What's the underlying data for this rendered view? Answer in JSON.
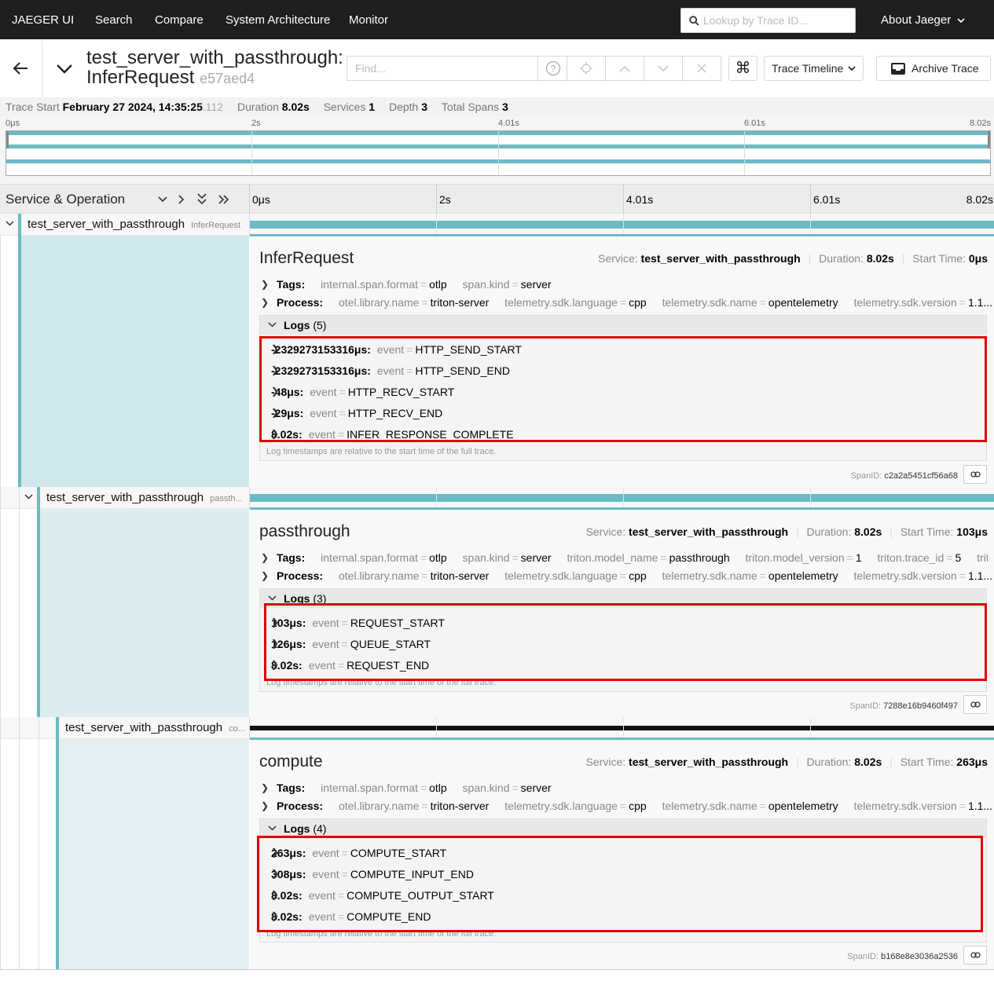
{
  "nav": {
    "brand": "JAEGER UI",
    "links": [
      "Search",
      "Compare",
      "System Architecture",
      "Monitor"
    ],
    "lookup_placeholder": "Lookup by Trace ID...",
    "about": "About Jaeger"
  },
  "trace": {
    "title_line1": "test_server_with_passthrough:",
    "title_line2": "InferRequest",
    "trace_id": "e57aed4",
    "find_placeholder": "Find...",
    "view_mode": "Trace Timeline",
    "archive_label": "Archive Trace"
  },
  "summary": {
    "start_label": "Trace Start",
    "start_value": "February 27 2024, 14:35:25",
    "start_ms": ".112",
    "duration_label": "Duration",
    "duration_value": "8.02s",
    "services_label": "Services",
    "services_value": "1",
    "depth_label": "Depth",
    "depth_value": "3",
    "spans_label": "Total Spans",
    "spans_value": "3"
  },
  "minimap_ticks": [
    "0μs",
    "2s",
    "4.01s",
    "6.01s",
    "8.02s"
  ],
  "timeline": {
    "column_title": "Service & Operation",
    "ticks": [
      "0μs",
      "2s",
      "4.01s",
      "6.01s",
      "8.02s"
    ]
  },
  "spans": [
    {
      "service": "test_server_with_passthrough",
      "operation": "InferRequest",
      "title": "InferRequest",
      "meta_service": "test_server_with_passthrough",
      "meta_duration": "8.02s",
      "meta_start": "0μs",
      "tags": [
        {
          "k": "internal.span.format",
          "v": "otlp"
        },
        {
          "k": "span.kind",
          "v": "server"
        }
      ],
      "process": [
        {
          "k": "otel.library.name",
          "v": "triton-server"
        },
        {
          "k": "telemetry.sdk.language",
          "v": "cpp"
        },
        {
          "k": "telemetry.sdk.name",
          "v": "opentelemetry"
        },
        {
          "k": "telemetry.sdk.version",
          "v": "1.1..."
        }
      ],
      "logs_count": "(5)",
      "logs": [
        {
          "t": "-2329273153316μs:",
          "v": "HTTP_SEND_START"
        },
        {
          "t": "-2329273153316μs:",
          "v": "HTTP_SEND_END"
        },
        {
          "t": "-48μs:",
          "v": "HTTP_RECV_START"
        },
        {
          "t": "-29μs:",
          "v": "HTTP_RECV_END"
        },
        {
          "t": "8.02s:",
          "v": "INFER_RESPONSE_COMPLETE"
        }
      ],
      "span_id": "c2a2a5451cf56a68"
    },
    {
      "service": "test_server_with_passthrough",
      "operation": "passth...",
      "title": "passthrough",
      "meta_service": "test_server_with_passthrough",
      "meta_duration": "8.02s",
      "meta_start": "103μs",
      "tags": [
        {
          "k": "internal.span.format",
          "v": "otlp"
        },
        {
          "k": "span.kind",
          "v": "server"
        },
        {
          "k": "triton.model_name",
          "v": "passthrough"
        },
        {
          "k": "triton.model_version",
          "v": "1"
        },
        {
          "k": "triton.trace_id",
          "v": "5"
        },
        {
          "k": "trit...",
          "v": ""
        }
      ],
      "process": [
        {
          "k": "otel.library.name",
          "v": "triton-server"
        },
        {
          "k": "telemetry.sdk.language",
          "v": "cpp"
        },
        {
          "k": "telemetry.sdk.name",
          "v": "opentelemetry"
        },
        {
          "k": "telemetry.sdk.version",
          "v": "1.1..."
        }
      ],
      "logs_count": "(3)",
      "logs": [
        {
          "t": "103μs:",
          "v": "REQUEST_START"
        },
        {
          "t": "126μs:",
          "v": "QUEUE_START"
        },
        {
          "t": "8.02s:",
          "v": "REQUEST_END"
        }
      ],
      "span_id": "7288e16b9460f497"
    },
    {
      "service": "test_server_with_passthrough",
      "operation": "co...",
      "title": "compute",
      "meta_service": "test_server_with_passthrough",
      "meta_duration": "8.02s",
      "meta_start": "263μs",
      "tags": [
        {
          "k": "internal.span.format",
          "v": "otlp"
        },
        {
          "k": "span.kind",
          "v": "server"
        }
      ],
      "process": [
        {
          "k": "otel.library.name",
          "v": "triton-server"
        },
        {
          "k": "telemetry.sdk.language",
          "v": "cpp"
        },
        {
          "k": "telemetry.sdk.name",
          "v": "opentelemetry"
        },
        {
          "k": "telemetry.sdk.version",
          "v": "1.1..."
        }
      ],
      "logs_count": "(4)",
      "logs": [
        {
          "t": "263μs:",
          "v": "COMPUTE_START"
        },
        {
          "t": "308μs:",
          "v": "COMPUTE_INPUT_END"
        },
        {
          "t": "8.02s:",
          "v": "COMPUTE_OUTPUT_START"
        },
        {
          "t": "8.02s:",
          "v": "COMPUTE_END"
        }
      ],
      "span_id": "b168e8e3036a2536"
    }
  ],
  "labels": {
    "service": "Service:",
    "duration": "Duration:",
    "start_time": "Start Time:",
    "tags": "Tags:",
    "process": "Process:",
    "logs": "Logs",
    "event_key": "event",
    "log_note": "Log timestamps are relative to the start time of the full trace.",
    "span_id": "SpanID:"
  },
  "colors": {
    "accent": "#6bbbc4",
    "highlight": "#e00000",
    "nav_bg": "#1e1e1e"
  },
  "icons": [
    "search-icon",
    "chevron-down-icon",
    "back-arrow-icon",
    "help-icon",
    "locate-icon",
    "chevron-up-icon",
    "close-icon",
    "command-icon",
    "archive-icon",
    "link-icon",
    "chevron-right-icon",
    "double-chevron-down-icon",
    "double-chevron-right-icon"
  ]
}
